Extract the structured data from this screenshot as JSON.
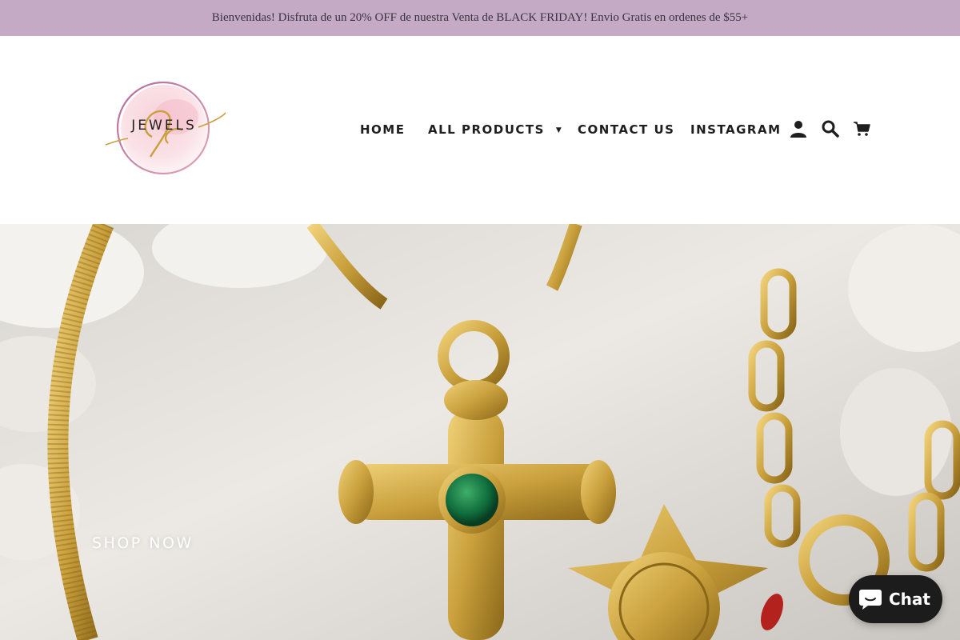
{
  "announcement": {
    "text": "Bienvenidas! Disfruta de un 20% OFF de nuestra Venta de BLACK FRIDAY! Envio Gratis en ordenes de $55+"
  },
  "logo": {
    "text": "JEWELS",
    "icon": "sc-jewels-logo"
  },
  "nav": {
    "home": "HOME",
    "all_products": "ALL PRODUCTS",
    "contact": "CONTACT US",
    "instagram": "INSTAGRAM"
  },
  "icons": {
    "account": "user-icon",
    "search": "search-icon",
    "cart": "cart-icon",
    "chat": "chat-bubble-icon"
  },
  "hero": {
    "cta": "SHOP NOW"
  },
  "chat": {
    "label": "Chat"
  },
  "colors": {
    "announcement_bg": "#c4aac4",
    "gold": "#c9a03c",
    "chat_bg": "#1c1c1c"
  }
}
